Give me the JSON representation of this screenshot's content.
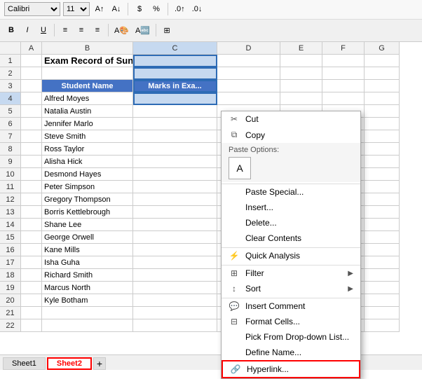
{
  "ribbon": {
    "font_name": "Calibri",
    "font_size": "11",
    "bold": "B",
    "italic": "I",
    "underline": "U",
    "align_left": "≡",
    "align_center": "≡",
    "align_right": "≡",
    "currency": "$",
    "percent": "%",
    "separator": ","
  },
  "title_cell": "Exam Record of Sunflower Kindergarten",
  "headers": {
    "col_a": "A",
    "col_b": "B",
    "col_c": "C",
    "col_d": "D",
    "col_e": "E",
    "col_f": "F",
    "col_g": "G"
  },
  "table_headers": {
    "student_name": "Student Name",
    "marks_in_exam": "Marks in Exa..."
  },
  "students": [
    "Alfred Moyes",
    "Natalia Austin",
    "Jennifer Marlo",
    "Steve Smith",
    "Ross Taylor",
    "Alisha Hick",
    "Desmond Hayes",
    "Peter Simpson",
    "Gregory Thompson",
    "Borris Kettlebrough",
    "Shane Lee",
    "George Orwell",
    "Kane Mills",
    "Isha Guha",
    "Richard Smith",
    "Marcus North",
    "Kyle Botham"
  ],
  "row_numbers": [
    "1",
    "2",
    "3",
    "4",
    "5",
    "6",
    "7",
    "8",
    "9",
    "10",
    "11",
    "12",
    "13",
    "14",
    "15",
    "16",
    "17",
    "18",
    "19",
    "20",
    "21",
    "22"
  ],
  "context_menu": {
    "cut": "Cut",
    "copy": "Copy",
    "paste_options_label": "Paste Options:",
    "paste_special": "Paste Special...",
    "insert": "Insert...",
    "delete": "Delete...",
    "clear_contents": "Clear Contents",
    "quick_analysis": "Quick Analysis",
    "filter": "Filter",
    "sort": "Sort",
    "insert_comment": "Insert Comment",
    "format_cells": "Format Cells...",
    "pick_from_dropdown": "Pick From Drop-down List...",
    "define_name": "Define Name...",
    "hyperlink": "Hyperlink..."
  },
  "tabs": {
    "sheet1": "Sheet1",
    "sheet2": "Sheet2",
    "add": "+"
  }
}
